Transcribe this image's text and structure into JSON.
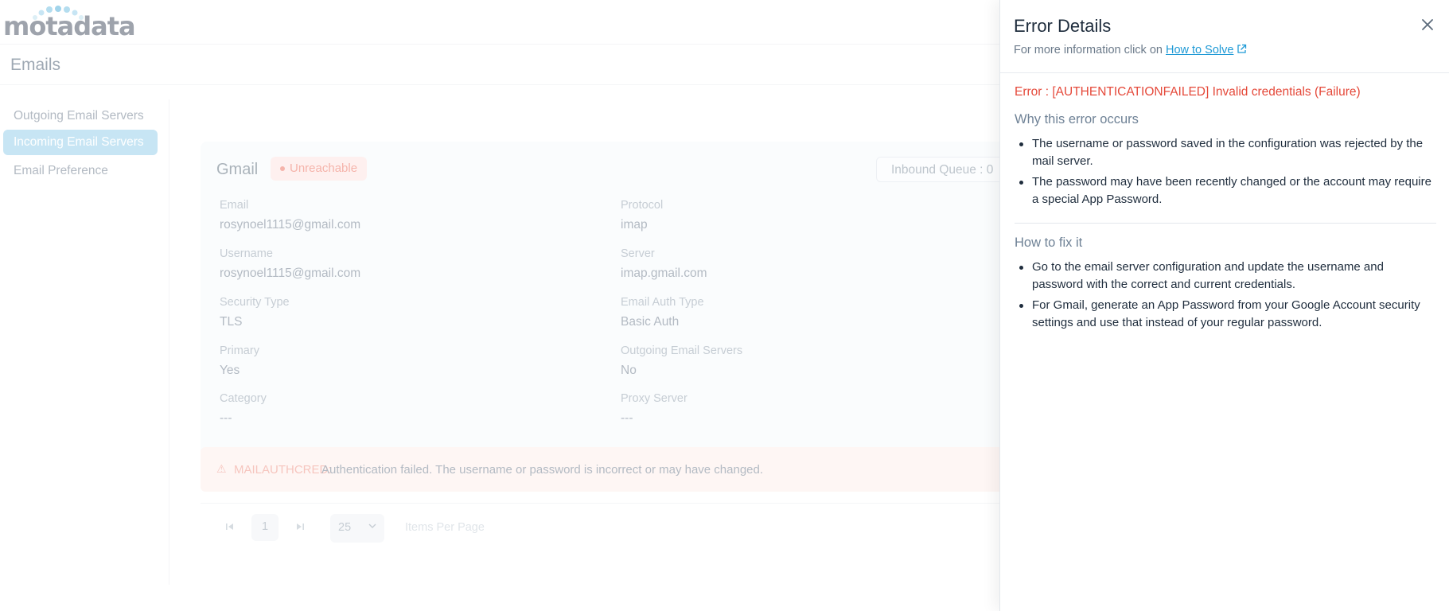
{
  "app": {
    "logo_text": "motadata",
    "page_title": "Emails"
  },
  "sidebar": {
    "items": [
      {
        "label": "Outgoing Email Servers"
      },
      {
        "label": "Incoming Email Servers"
      },
      {
        "label": "Email Preference"
      }
    ]
  },
  "server_card": {
    "name": "Gmail",
    "status": "Unreachable",
    "inbound_queue": "Inbound Queue : 0",
    "fields": [
      {
        "label": "Email",
        "value": "rosynoel1115@gmail.com"
      },
      {
        "label": "Protocol",
        "value": "imap"
      },
      {
        "label": "Username",
        "value": "rosynoel1115@gmail.com"
      },
      {
        "label": "Server",
        "value": "imap.gmail.com"
      },
      {
        "label": "Security Type",
        "value": "TLS"
      },
      {
        "label": "Email Auth Type",
        "value": "Basic Auth"
      },
      {
        "label": "Primary",
        "value": "Yes"
      },
      {
        "label": "Outgoing Email Servers",
        "value": "No"
      },
      {
        "label": "Category",
        "value": "---"
      },
      {
        "label": "Proxy Server",
        "value": "---"
      }
    ],
    "error_code": "MAILAUTHCRED:",
    "error_message": "Authentication failed. The username or password is incorrect or may have changed."
  },
  "pagination": {
    "current_page": "1",
    "page_size": "25",
    "items_per_page_label": "Items Per Page"
  },
  "drawer": {
    "title": "Error Details",
    "subtitle_prefix": "For more information click on",
    "link_label": "How to Solve",
    "error_line": "Error : [AUTHENTICATIONFAILED] Invalid credentials (Failure)",
    "why_title": "Why this error occurs",
    "why_items": [
      "The username or password saved in the configuration was rejected by the mail server.",
      "The password may have been recently changed or the account may require a special App Password."
    ],
    "fix_title": "How to fix it",
    "fix_items": [
      "Go to the email server configuration and update the username and password with the correct and current credentials.",
      "For Gmail, generate an App Password from your Google Account security settings and use that instead of your regular password."
    ]
  },
  "colors": {
    "accent": "#1f9ad6",
    "error": "#e5493a",
    "nav_active": "#a9d8ee"
  }
}
